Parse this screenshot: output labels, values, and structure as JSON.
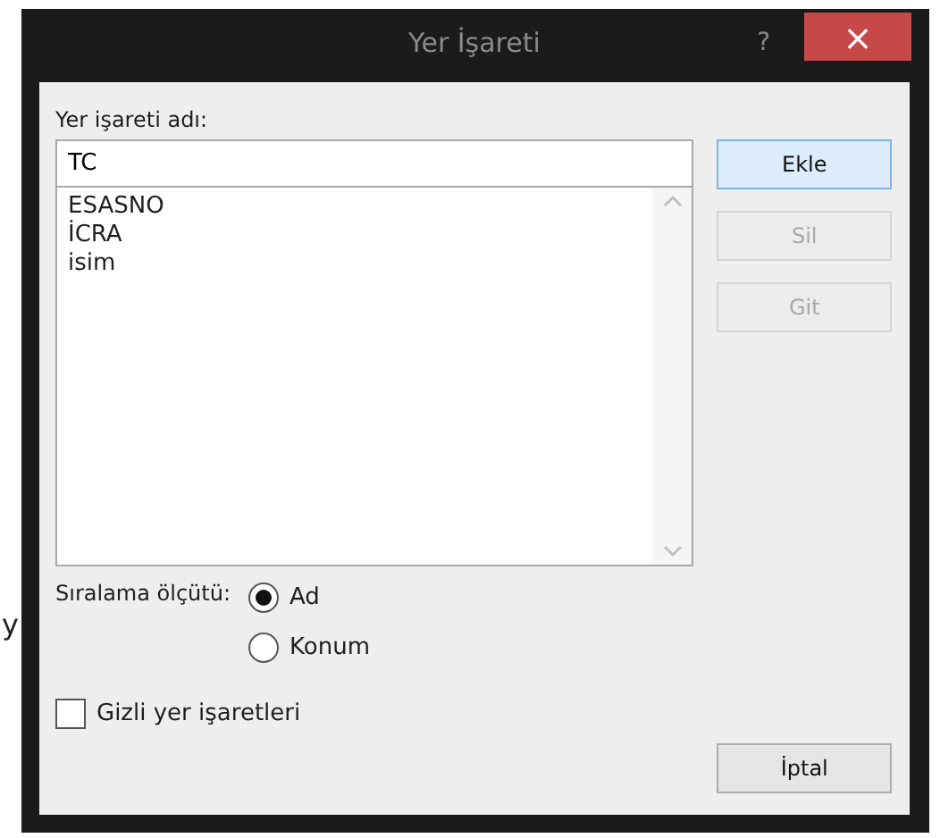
{
  "background_text": "y",
  "window": {
    "title": "Yer İşareti",
    "help": "?",
    "close": "×"
  },
  "name_label": "Yer işareti adı:",
  "name_field": {
    "value": "TC"
  },
  "bookmarks": [
    {
      "label": "ESASNO",
      "selected": false
    },
    {
      "label": "İCRA",
      "selected": false
    },
    {
      "label": "isim",
      "selected": false
    }
  ],
  "buttons": [
    {
      "label": "Ekle",
      "disabled": false,
      "default": true
    },
    {
      "label": "Sil",
      "disabled": true,
      "default": false
    },
    {
      "label": "Git",
      "disabled": true,
      "default": false
    }
  ],
  "sort": {
    "label": "Sıralama ölçütü:",
    "options": [
      {
        "label": "Ad",
        "selected": true
      },
      {
        "label": "Konum",
        "selected": false
      }
    ]
  },
  "hidden_bookmarks": {
    "label": "Gizli yer işaretleri",
    "checked": false
  },
  "cancel_button": {
    "label": "İptal"
  }
}
